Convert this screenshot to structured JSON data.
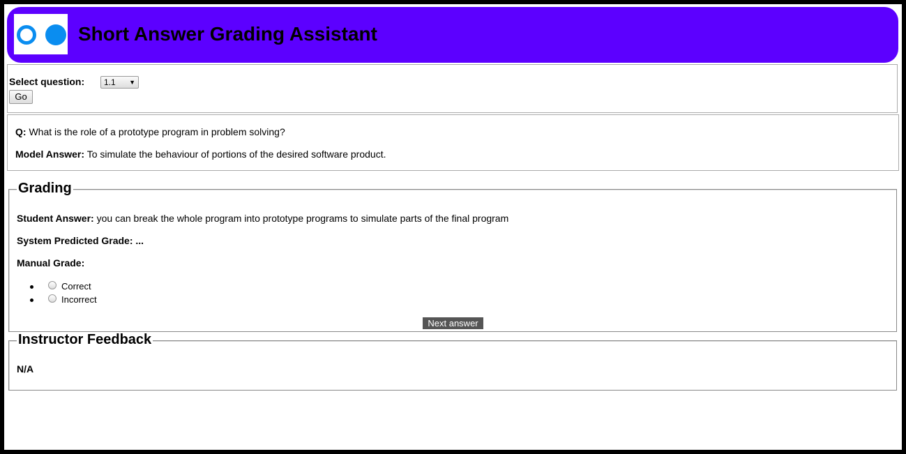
{
  "header": {
    "title": "Short Answer Grading Assistant",
    "brand_color": "#5c00ff",
    "logo_color": "#0a8df0"
  },
  "question_select": {
    "label": "Select question:",
    "selected": "1.1",
    "go_label": "Go"
  },
  "question": {
    "q_label": "Q:",
    "q_text": "What is the role of a prototype program in problem solving?",
    "model_label": "Model Answer:",
    "model_text": "To simulate the behaviour of portions of the desired software product."
  },
  "grading": {
    "legend": "Grading",
    "student_label": "Student Answer:",
    "student_text": "you can break the whole program into prototype programs to simulate parts of the final program",
    "predicted_label": "System Predicted Grade:",
    "predicted_value": "...",
    "manual_label": "Manual Grade:",
    "options": [
      "Correct",
      "Incorrect"
    ],
    "next_label": "Next answer"
  },
  "feedback": {
    "legend": "Instructor Feedback",
    "value": "N/A"
  }
}
